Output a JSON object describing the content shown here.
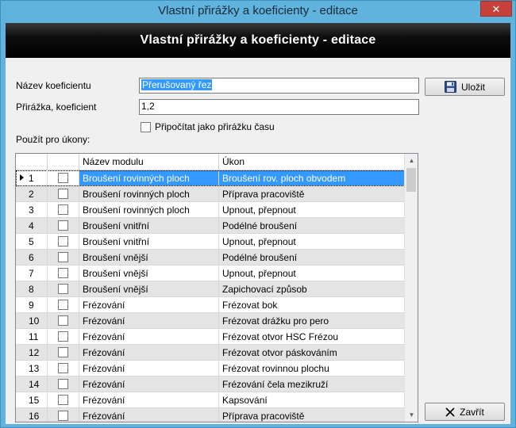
{
  "window": {
    "title": "Vlastní přirážky a koeficienty - editace",
    "close_glyph": "✕"
  },
  "banner": {
    "title": "Vlastní přirážky a koeficienty - editace"
  },
  "form": {
    "name_label": "Název koeficientu",
    "name_value": "Přerušovaný řez",
    "coef_label": "Přirážka, koeficient",
    "coef_value": "1,2",
    "time_checkbox_label": "Připočítat jako přirážku času",
    "time_checkbox_checked": false,
    "use_for_label": "Použít pro úkony:"
  },
  "buttons": {
    "save_label": "Uložit",
    "save_icon": "floppy-disk-icon",
    "close_label": "Zavřít",
    "close_icon": "x-icon"
  },
  "grid": {
    "columns": [
      "",
      "",
      "Název modulu",
      "Úkon"
    ],
    "selected_row": 0,
    "rows": [
      {
        "num": "1",
        "checked": false,
        "module": "Broušení rovinných ploch",
        "op": "Broušení rov. ploch obvodem"
      },
      {
        "num": "2",
        "checked": false,
        "module": "Broušení rovinných ploch",
        "op": "Příprava pracoviště"
      },
      {
        "num": "3",
        "checked": false,
        "module": "Broušení rovinných ploch",
        "op": "Upnout, přepnout"
      },
      {
        "num": "4",
        "checked": false,
        "module": "Broušení vnitřní",
        "op": "Podélné broušení"
      },
      {
        "num": "5",
        "checked": false,
        "module": "Broušení vnitřní",
        "op": "Upnout, přepnout"
      },
      {
        "num": "6",
        "checked": false,
        "module": "Broušení vnější",
        "op": "Podélné broušení"
      },
      {
        "num": "7",
        "checked": false,
        "module": "Broušení vnější",
        "op": "Upnout, přepnout"
      },
      {
        "num": "8",
        "checked": false,
        "module": "Broušení vnější",
        "op": "Zapichovací způsob"
      },
      {
        "num": "9",
        "checked": false,
        "module": "Frézování",
        "op": "Frézovat bok"
      },
      {
        "num": "10",
        "checked": false,
        "module": "Frézování",
        "op": "Frézovat drážku pro pero"
      },
      {
        "num": "11",
        "checked": false,
        "module": "Frézování",
        "op": "Frézovat otvor HSC Frézou"
      },
      {
        "num": "12",
        "checked": false,
        "module": "Frézování",
        "op": "Frézovat otvor páskováním"
      },
      {
        "num": "13",
        "checked": false,
        "module": "Frézování",
        "op": "Frézovat rovinnou plochu"
      },
      {
        "num": "14",
        "checked": false,
        "module": "Frézování",
        "op": "Frézování čela mezikruží"
      },
      {
        "num": "15",
        "checked": false,
        "module": "Frézování",
        "op": "Kapsování"
      },
      {
        "num": "16",
        "checked": false,
        "module": "Frézování",
        "op": "Příprava pracoviště"
      }
    ]
  }
}
